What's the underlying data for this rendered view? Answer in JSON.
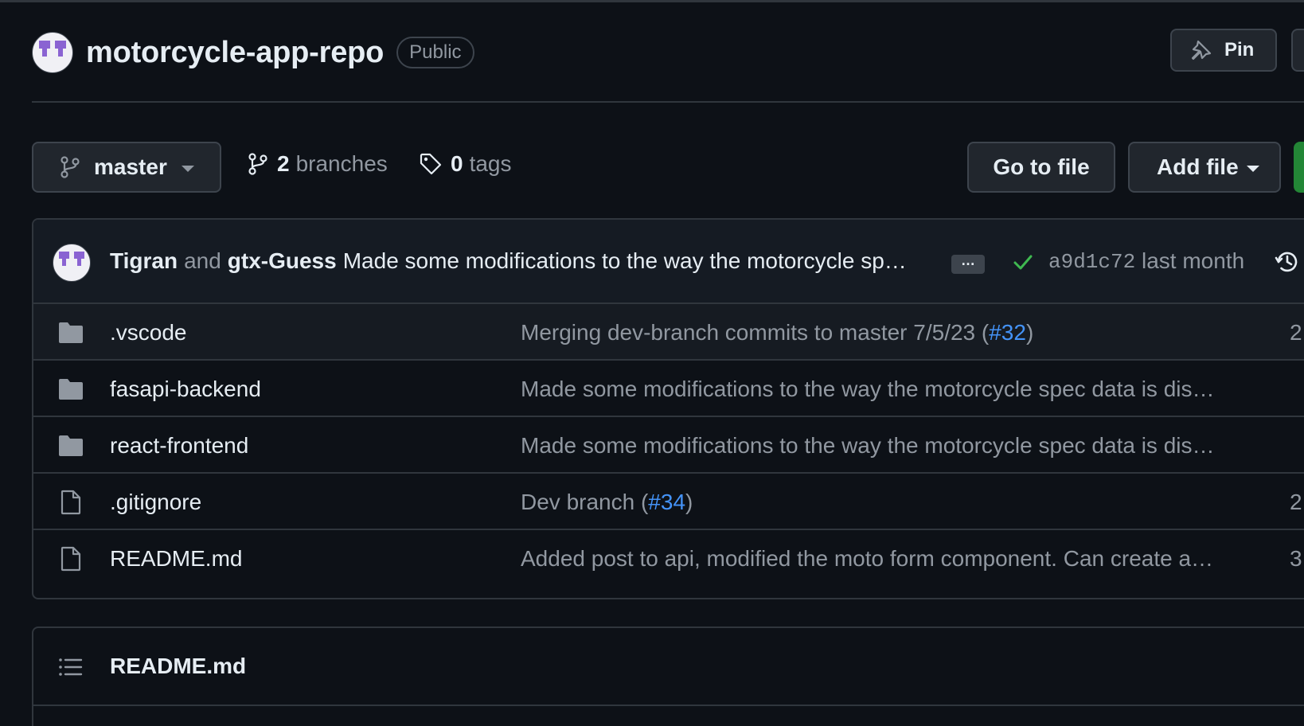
{
  "repo": {
    "name": "motorcycle-app-repo",
    "visibility": "Public",
    "pin_label": "Pin"
  },
  "toolbar": {
    "branch": "master",
    "branches_count": "2",
    "branches_label": "branches",
    "tags_count": "0",
    "tags_label": "tags",
    "go_to_file": "Go to file",
    "add_file": "Add file"
  },
  "commit": {
    "author1": "Tigran",
    "and": "and",
    "author2": "gtx-Guess",
    "message": "Made some modifications to the way the motorcycle sp…",
    "more": "…",
    "sha": "a9d1c72",
    "when": "last month",
    "status_color": "#3fb950"
  },
  "files": [
    {
      "name": ".vscode",
      "type": "folder",
      "msg": "Merging dev-branch commits to master 7/5/23 (",
      "pr": "#32",
      "msg_end": ")",
      "age": "2"
    },
    {
      "name": "fasapi-backend",
      "type": "folder",
      "msg": "Made some modifications to the way the motorcycle spec data is dis…",
      "pr": "",
      "msg_end": "",
      "age": ""
    },
    {
      "name": "react-frontend",
      "type": "folder",
      "msg": "Made some modifications to the way the motorcycle spec data is dis…",
      "pr": "",
      "msg_end": "",
      "age": ""
    },
    {
      "name": ".gitignore",
      "type": "file",
      "msg": "Dev branch (",
      "pr": "#34",
      "msg_end": ")",
      "age": "2"
    },
    {
      "name": "README.md",
      "type": "file",
      "msg": "Added post to api, modified the moto form component. Can create a…",
      "pr": "",
      "msg_end": "",
      "age": "3"
    }
  ],
  "readme": {
    "title": "README.md"
  },
  "colors": {
    "background": "#0d1117",
    "link": "#4493f8",
    "code_button": "#238636",
    "muted": "#9198a1"
  }
}
